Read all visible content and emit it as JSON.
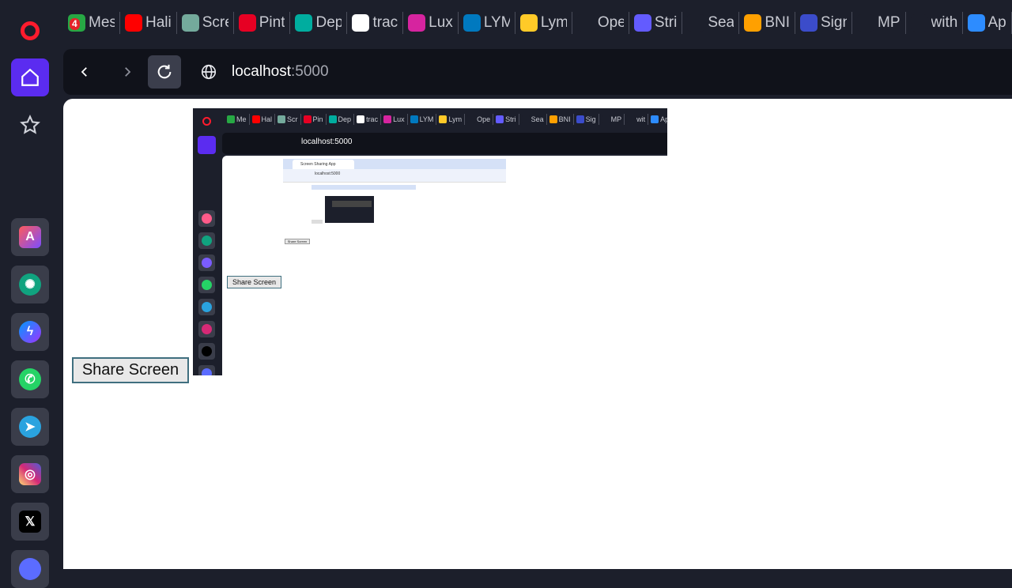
{
  "bookmarks": [
    {
      "label": "Mes",
      "color": "#27a844",
      "badge": "4"
    },
    {
      "label": "Hali",
      "color": "#ff0000"
    },
    {
      "label": "Scre",
      "color": "#74aa9c"
    },
    {
      "label": "Pint",
      "color": "#e60023"
    },
    {
      "label": "Dep",
      "color": "#00ad9f"
    },
    {
      "label": "trac",
      "color": "#ffffff"
    },
    {
      "label": "Lux",
      "color": "#d6249f"
    },
    {
      "label": "LYM",
      "color": "#0079bf"
    },
    {
      "label": "Lym",
      "color": "#ffca28"
    },
    {
      "label": "Ope",
      "color": "#1c1f2b"
    },
    {
      "label": "Stri",
      "color": "#635bff"
    },
    {
      "label": "Sea",
      "color": "#1c1f2b"
    },
    {
      "label": "BNI",
      "color": "#ffa000"
    },
    {
      "label": "Sign",
      "color": "#3b4cca"
    },
    {
      "label": "MP",
      "color": "#1c1f2b"
    },
    {
      "label": "with",
      "color": "#1c1f2b"
    },
    {
      "label": "Ap",
      "color": "#2d8cff"
    }
  ],
  "address": {
    "host": "localhost",
    "port": ":5000"
  },
  "page": {
    "share_button": "Share Screen"
  },
  "video": {
    "url": "localhost:5000",
    "tab_title": "Screen Sharing App",
    "addr": "localhost:5000",
    "share_button": "Share Screen",
    "share_button_nested": "Share Screen",
    "bookmarks": [
      "Me",
      "Hal",
      "Scr",
      "Pin",
      "Dep",
      "trac",
      "Lux",
      "LYM",
      "Lym",
      "Ope",
      "Stri",
      "Sea",
      "BNI",
      "Sig",
      "MP",
      "wit",
      "Ap"
    ]
  },
  "colors": {
    "accent": "#5b2cf0",
    "sidebar": "#1c1f2b",
    "opera_red": "#ff1b2d"
  }
}
